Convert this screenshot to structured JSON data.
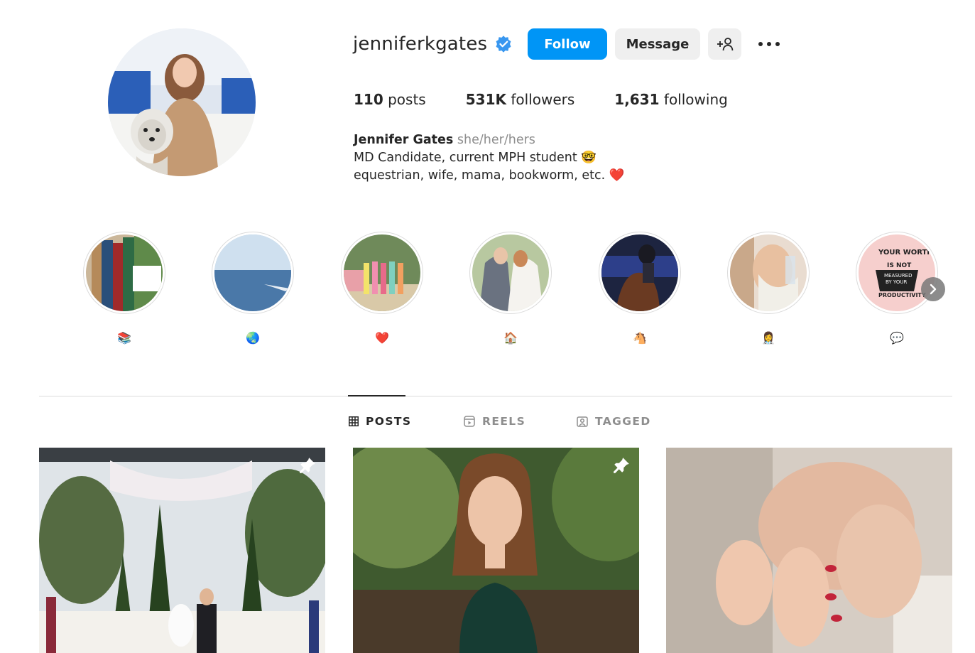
{
  "profile": {
    "username": "jenniferkgates",
    "verified": true,
    "follow_label": "Follow",
    "message_label": "Message",
    "stats": {
      "posts_count": "110",
      "posts_label": "posts",
      "followers_count": "531K",
      "followers_label": "followers",
      "following_count": "1,631",
      "following_label": "following"
    },
    "bio": {
      "name": "Jennifer Gates",
      "pronouns": "she/her/hers",
      "line1": "MD Candidate, current MPH student 🤓",
      "line2": "equestrian, wife, mama, bookworm, etc. ❤️"
    }
  },
  "highlights": [
    {
      "label": "📚",
      "icon": "books-emoji"
    },
    {
      "label": "🌏",
      "icon": "globe-emoji"
    },
    {
      "label": "❤️",
      "icon": "heart-emoji"
    },
    {
      "label": "🏠",
      "icon": "house-emoji"
    },
    {
      "label": "🐴",
      "icon": "horse-emoji"
    },
    {
      "label": "👩‍⚕️",
      "icon": "health-worker-emoji"
    },
    {
      "label": "💬",
      "icon": "speech-bubble-emoji"
    }
  ],
  "highlight_text": {
    "poster_line1": "YOUR WORTH",
    "poster_line2": "IS NOT",
    "poster_line3": "MEASURED",
    "poster_line4": "BY YOUR",
    "poster_line5": "PRODUCTIVITY"
  },
  "tabs": [
    {
      "label": "POSTS",
      "icon": "grid-icon",
      "active": true
    },
    {
      "label": "REELS",
      "icon": "reels-icon",
      "active": false
    },
    {
      "label": "TAGGED",
      "icon": "tagged-icon",
      "active": false
    }
  ],
  "posts": [
    {
      "subject": "wedding ceremony",
      "pinned": true
    },
    {
      "subject": "portrait in green dress",
      "pinned": true
    },
    {
      "subject": "baby feet held by hands",
      "pinned": false
    }
  ],
  "colors": {
    "accent": "#0095f6",
    "verified": "#3897f0",
    "secondary_button": "#efefef",
    "muted_text": "#8e8e8e",
    "divider": "#dbdbdb"
  }
}
